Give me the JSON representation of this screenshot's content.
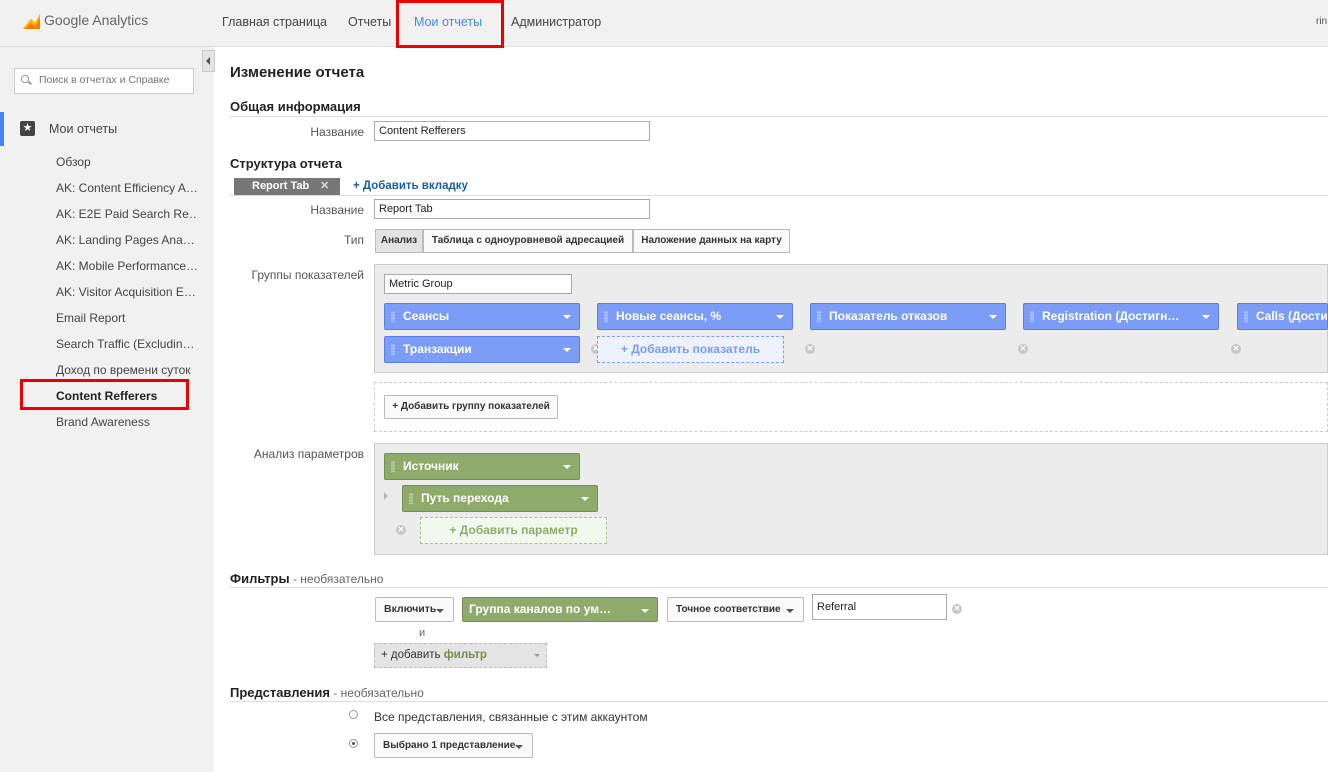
{
  "header": {
    "logo_text": "Google Analytics",
    "nav": [
      "Главная страница",
      "Отчеты",
      "Мои отчеты",
      "Администратор"
    ],
    "user_snippet": "rin"
  },
  "sidebar": {
    "search_placeholder": "Поиск в отчетах и Справке",
    "section_label": "Мои отчеты",
    "items": [
      "Обзор",
      "AK: Content Efficiency A…",
      "AK: E2E Paid Search Re…",
      "AK: Landing Pages Ana…",
      "AK: Mobile Performance…",
      "AK: Visitor Acquisition E…",
      "Email Report",
      "Search Traffic (Excludin…",
      "Доход по времени суток",
      "Content Refferers",
      "Brand Awareness"
    ],
    "selected_index": 9
  },
  "main": {
    "page_title": "Изменение отчета",
    "general": {
      "heading": "Общая информация",
      "name_label": "Название",
      "name_value": "Content Refferers"
    },
    "structure": {
      "heading": "Структура отчета",
      "tab_label": "Report Tab",
      "add_tab": "+ Добавить вкладку",
      "name_label": "Название",
      "name_value": "Report Tab",
      "type_label": "Тип",
      "type_options": [
        "Анализ",
        "Таблица с одноуровневой адресацией",
        "Наложение данных на карту"
      ],
      "metric_groups_label": "Группы показателей",
      "metric_group_name": "Metric Group",
      "metrics_row1": [
        "Сеансы",
        "Новые сеансы, %",
        "Показатель отказов",
        "Registration (Достигн…",
        "Calls (Дости"
      ],
      "metrics_row2": [
        "Транзакции"
      ],
      "add_metric": "+ Добавить показатель",
      "add_metric_group": "+ Добавить группу показателей",
      "dimensions_label": "Анализ параметров",
      "dimensions": [
        "Источник",
        "Путь перехода"
      ],
      "add_dimension": "+ Добавить параметр"
    },
    "filters": {
      "heading": "Фильтры",
      "optional": " - необязательно",
      "include": "Включить",
      "dimension": "Группа каналов по ум…",
      "match_type": "Точное соответствие",
      "value": "Referral",
      "and_label": "и",
      "add_filter_prefix": "+ добавить",
      "add_filter_word": "фильтр"
    },
    "views": {
      "heading": "Представления",
      "optional": " - необязательно",
      "all_views": "Все представления, связанные с этим аккаунтом",
      "selected_views": "Выбрано 1 представление"
    }
  },
  "colors": {
    "accent_blue": "#4285f4",
    "metric_chip": "#7b9cf7",
    "dimension_chip": "#8eab6c",
    "highlight_red": "#e00000"
  }
}
